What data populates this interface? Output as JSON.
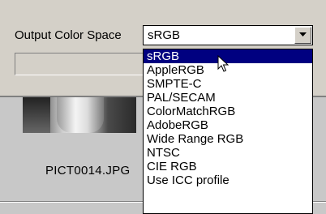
{
  "dialog": {
    "output_color_space_label": "Output Color Space"
  },
  "combo": {
    "value": "sRGB",
    "options": [
      "sRGB",
      "AppleRGB",
      "SMPTE-C",
      "PAL/SECAM",
      "ColorMatchRGB",
      "AdobeRGB",
      "Wide Range RGB",
      "NTSC",
      "CIE RGB",
      "Use ICC profile"
    ],
    "selected_index": 0
  },
  "thumbnail": {
    "filename": "PICT0014.JPG"
  },
  "colors": {
    "selection": "#000080",
    "panel": "#d4d0c8"
  },
  "icons": {
    "dropdown_arrow": "chevron-down-icon",
    "cursor": "mouse-pointer-icon"
  }
}
